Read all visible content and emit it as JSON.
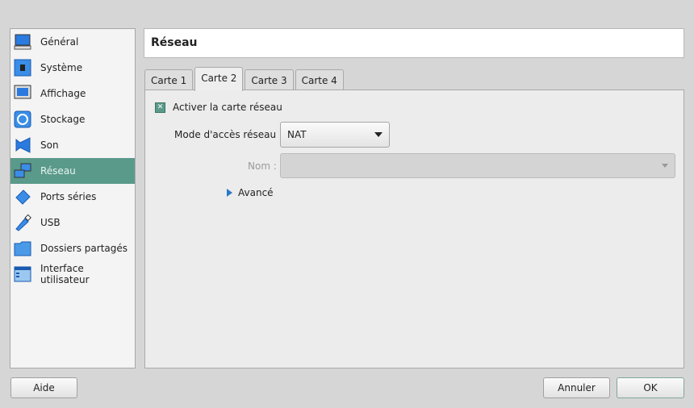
{
  "sidebar": {
    "items": [
      {
        "label": "Général",
        "icon": "monitor-icon"
      },
      {
        "label": "Système",
        "icon": "chip-icon"
      },
      {
        "label": "Affichage",
        "icon": "display-icon"
      },
      {
        "label": "Stockage",
        "icon": "disk-icon"
      },
      {
        "label": "Son",
        "icon": "speaker-icon"
      },
      {
        "label": "Réseau",
        "icon": "network-icon",
        "selected": true
      },
      {
        "label": "Ports séries",
        "icon": "serial-port-icon"
      },
      {
        "label": "USB",
        "icon": "usb-icon"
      },
      {
        "label": "Dossiers partagés",
        "icon": "folder-icon"
      },
      {
        "label": "Interface utilisateur",
        "icon": "window-icon"
      }
    ]
  },
  "header": {
    "title": "Réseau"
  },
  "tabs": [
    {
      "label": "Carte 1"
    },
    {
      "label": "Carte 2",
      "active": true
    },
    {
      "label": "Carte 3"
    },
    {
      "label": "Carte 4"
    }
  ],
  "adapter": {
    "enable_label": "Activer la carte réseau",
    "enabled": true,
    "mode_label": "Mode d'accès réseau :",
    "mode_value": "NAT",
    "name_label": "Nom :",
    "name_value": "",
    "advanced_label": "Avancé"
  },
  "buttons": {
    "help": "Aide",
    "cancel": "Annuler",
    "ok": "OK"
  },
  "colors": {
    "selection": "#5a9a8a"
  }
}
